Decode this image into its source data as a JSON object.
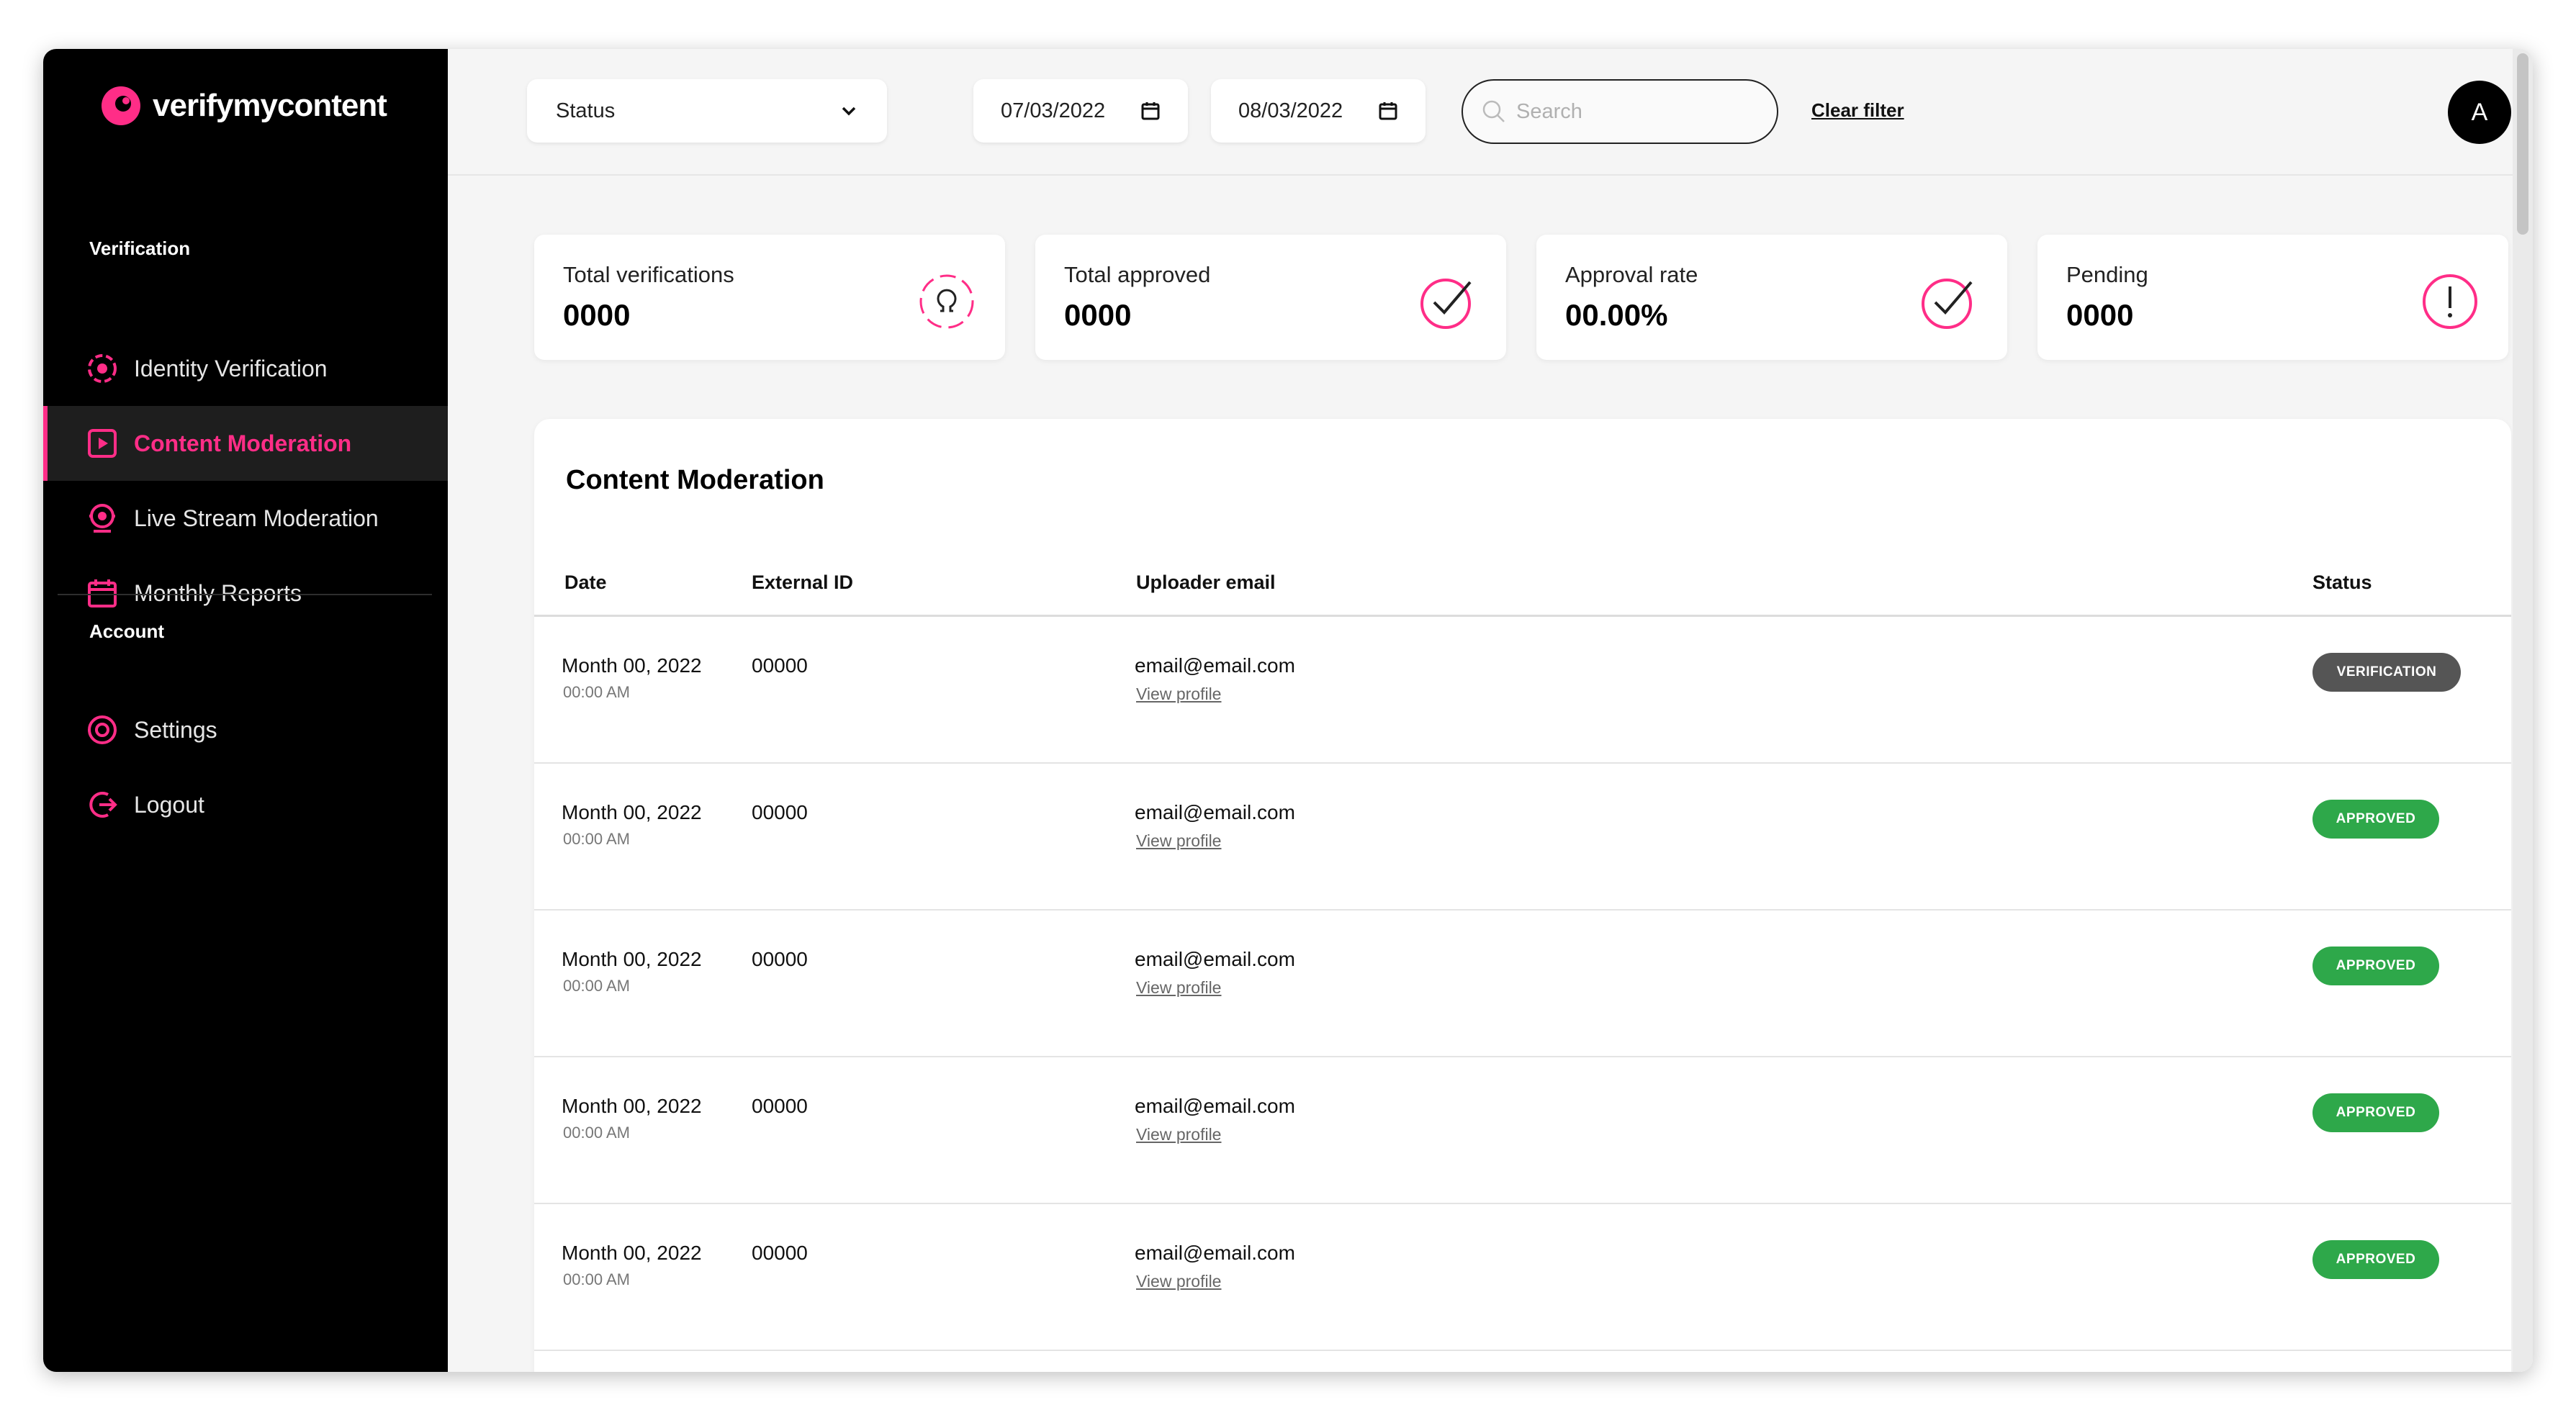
{
  "brand": {
    "name": "verifymycontent",
    "accent": "#ff2d87"
  },
  "sidebar": {
    "sections": [
      {
        "title": "Verification"
      },
      {
        "title": "Account"
      }
    ],
    "items": [
      {
        "label": "Identity Verification",
        "icon": "identity-icon"
      },
      {
        "label": "Content Moderation",
        "icon": "play-icon",
        "active": true
      },
      {
        "label": "Live Stream Moderation",
        "icon": "webcam-icon"
      },
      {
        "label": "Monthly Reports",
        "icon": "calendar-icon"
      },
      {
        "label": "Settings",
        "icon": "settings-icon"
      },
      {
        "label": "Logout",
        "icon": "logout-icon"
      }
    ]
  },
  "filters": {
    "status_label": "Status",
    "date_from": "07/03/2022",
    "date_to": "08/03/2022",
    "search_placeholder": "Search",
    "clear_label": "Clear filter"
  },
  "user": {
    "avatar_initial": "A"
  },
  "stats": [
    {
      "label": "Total verifications",
      "value": "0000",
      "icon": "identity-circle-icon"
    },
    {
      "label": "Total approved",
      "value": "0000",
      "icon": "check-circle-icon"
    },
    {
      "label": "Approval rate",
      "value": "00.00%",
      "icon": "check-circle-icon"
    },
    {
      "label": "Pending",
      "value": "0000",
      "icon": "exclamation-circle-icon"
    }
  ],
  "table": {
    "title": "Content Moderation",
    "columns": [
      "Date",
      "External ID",
      "Uploader email",
      "Status"
    ],
    "rows": [
      {
        "date": "Month 00, 2022",
        "time": "00:00 AM",
        "external_id": "00000",
        "email": "email@email.com",
        "link": "View profile",
        "status": "VERIFICATION"
      },
      {
        "date": "Month 00, 2022",
        "time": "00:00 AM",
        "external_id": "00000",
        "email": "email@email.com",
        "link": "View profile",
        "status": "APPROVED"
      },
      {
        "date": "Month 00, 2022",
        "time": "00:00 AM",
        "external_id": "00000",
        "email": "email@email.com",
        "link": "View profile",
        "status": "APPROVED"
      },
      {
        "date": "Month 00, 2022",
        "time": "00:00 AM",
        "external_id": "00000",
        "email": "email@email.com",
        "link": "View profile",
        "status": "APPROVED"
      },
      {
        "date": "Month 00, 2022",
        "time": "00:00 AM",
        "external_id": "00000",
        "email": "email@email.com",
        "link": "View profile",
        "status": "APPROVED"
      }
    ],
    "status_colors": {
      "VERIFICATION": "#555555",
      "APPROVED": "#2ea84a"
    }
  }
}
